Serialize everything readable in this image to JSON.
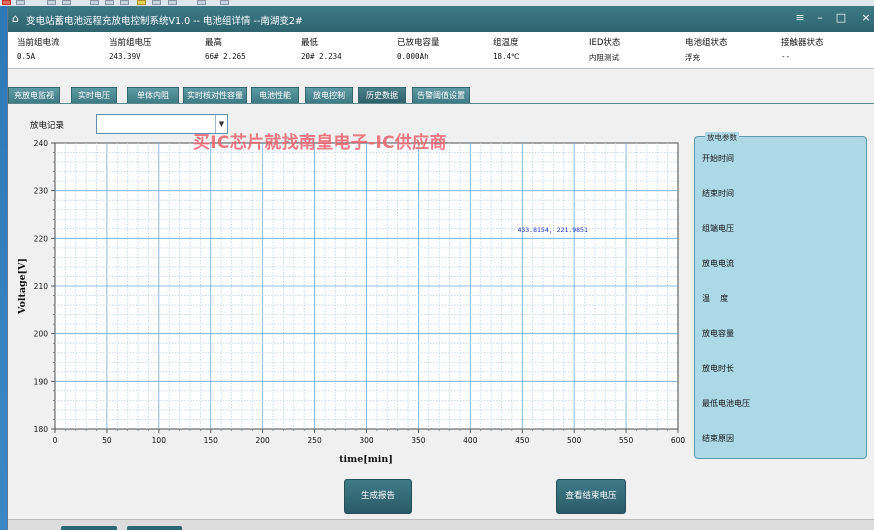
{
  "window": {
    "title": "变电站蓄电池远程充放电控制系统V1.0 -- 电池组详情 --南湖变2#",
    "controls": [
      "≡",
      "–",
      "□",
      "×"
    ]
  },
  "status": [
    {
      "label": "当前组电流",
      "value": "0.5A"
    },
    {
      "label": "当前组电压",
      "value": "243.39V"
    },
    {
      "label": "最高",
      "value": "66# 2.265"
    },
    {
      "label": "最低",
      "value": "20# 2.234"
    },
    {
      "label": "已放电容量",
      "value": "0.000Ah"
    },
    {
      "label": "组温度",
      "value": "18.4℃"
    },
    {
      "label": "IED状态",
      "value": "内阻测试"
    },
    {
      "label": "电池组状态",
      "value": "浮充"
    },
    {
      "label": "接触器状态",
      "value": "--"
    }
  ],
  "tabs": [
    "充放电监视",
    "实时电压",
    "单体内阻",
    "实时核对性容量",
    "电池性能",
    "放电控制",
    "历史数据",
    "告警阈值设置"
  ],
  "active_tab": "历史数据",
  "record": {
    "label": "放电记录",
    "value": ""
  },
  "watermark": "买IC芯片就找南皇电子-IC供应商",
  "chart_data": {
    "type": "line",
    "xlabel": "time[min]",
    "ylabel": "Voltage[V]",
    "xlim": [
      0,
      600
    ],
    "ylim": [
      180,
      240
    ],
    "xticks": [
      0,
      50,
      100,
      150,
      200,
      250,
      300,
      350,
      400,
      450,
      500,
      550,
      600
    ],
    "yticks": [
      180,
      190,
      200,
      210,
      220,
      230,
      240
    ],
    "grid": true,
    "series": [],
    "annotation": {
      "text": "433.8154, 221.9851",
      "x": 433.8154,
      "y": 221.9851
    }
  },
  "params": {
    "title": "放电参数",
    "items": [
      "开始时间",
      "结束时间",
      "组端电压",
      "放电电流",
      "温    度",
      "放电容量",
      "放电时长",
      "最低电池电压",
      "结束原因"
    ]
  },
  "buttons": {
    "report": "生成报告",
    "end_voltage": "查看结束电压"
  }
}
